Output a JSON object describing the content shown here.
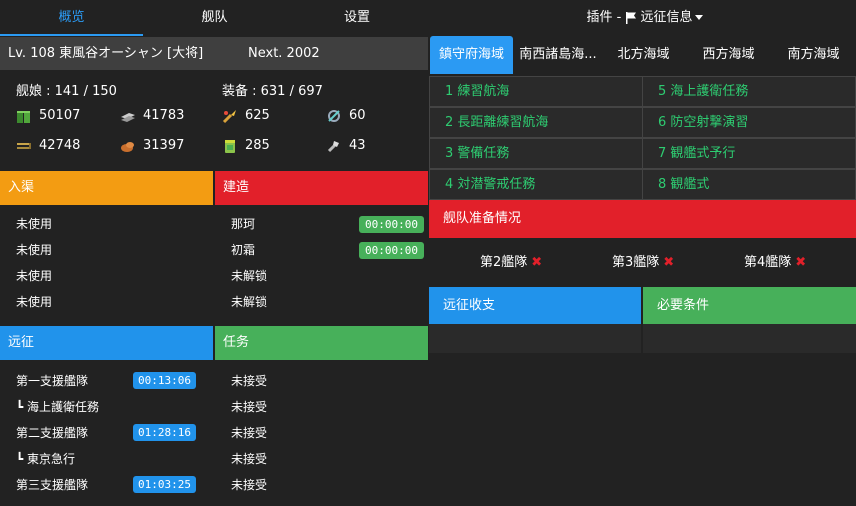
{
  "nav": {
    "tabs": [
      "概览",
      "舰队",
      "设置"
    ],
    "plugin_label": "插件 - ",
    "plugin_name": "远征信息"
  },
  "admiral": {
    "level_line": "Lv. 108 東風谷オーシャン [大将]",
    "next": "Next. 2002"
  },
  "counts": {
    "ships": "舰娘 : 141 / 150",
    "equipment": "装备 : 631 / 697"
  },
  "resources": [
    {
      "icon": "fuel-icon",
      "value": "50107"
    },
    {
      "icon": "steel-icon",
      "value": "41783"
    },
    {
      "icon": "instant-repair-icon",
      "value": "625"
    },
    {
      "icon": "development-material-icon",
      "value": "60"
    },
    {
      "icon": "ammo-icon",
      "value": "42748"
    },
    {
      "icon": "bauxite-icon",
      "value": "31397"
    },
    {
      "icon": "instant-construction-icon",
      "value": "285"
    },
    {
      "icon": "improvement-material-icon",
      "value": "43"
    }
  ],
  "docks": {
    "title": "入渠",
    "rows": [
      "未使用",
      "未使用",
      "未使用",
      "未使用"
    ]
  },
  "construction": {
    "title": "建造",
    "rows": [
      {
        "name": "那珂",
        "time": "00:00:00"
      },
      {
        "name": "初霜",
        "time": "00:00:00"
      },
      {
        "name": "未解锁",
        "time": ""
      },
      {
        "name": "未解锁",
        "time": ""
      }
    ]
  },
  "expedition": {
    "title": "远征",
    "rows": [
      {
        "name": "第一支援艦隊",
        "time": "00:13:06"
      },
      {
        "name": "┗ 海上護衛任務",
        "time": ""
      },
      {
        "name": "第二支援艦隊",
        "time": "01:28:16"
      },
      {
        "name": "┗ 東京急行",
        "time": ""
      },
      {
        "name": "第三支援艦隊",
        "time": "01:03:25"
      }
    ]
  },
  "quests": {
    "title": "任务",
    "rows": [
      "未接受",
      "未接受",
      "未接受",
      "未接受",
      "未接受"
    ]
  },
  "seas": {
    "tabs": [
      "鎮守府海域",
      "南西諸島海...",
      "北方海域",
      "西方海域",
      "南方海域"
    ],
    "missions": [
      "1 練習航海",
      "5 海上護衛任務",
      "2 長距離練習航海",
      "6 防空射撃演習",
      "3 警備任務",
      "7 観艦式予行",
      "4 対潜警戒任務",
      "8 観艦式"
    ]
  },
  "fleet_prep": {
    "title": "舰队准备情况",
    "fleets": [
      "第2艦隊",
      "第3艦隊",
      "第4艦隊"
    ]
  },
  "income": {
    "title": "远征收支"
  },
  "requirements": {
    "title": "必要条件"
  },
  "colors": {
    "accent": "#2b9af3",
    "orange": "#f39c12",
    "red": "#e2202a",
    "blue": "#2193eb",
    "green": "#47b05a",
    "mission_text": "#2ecc71"
  }
}
